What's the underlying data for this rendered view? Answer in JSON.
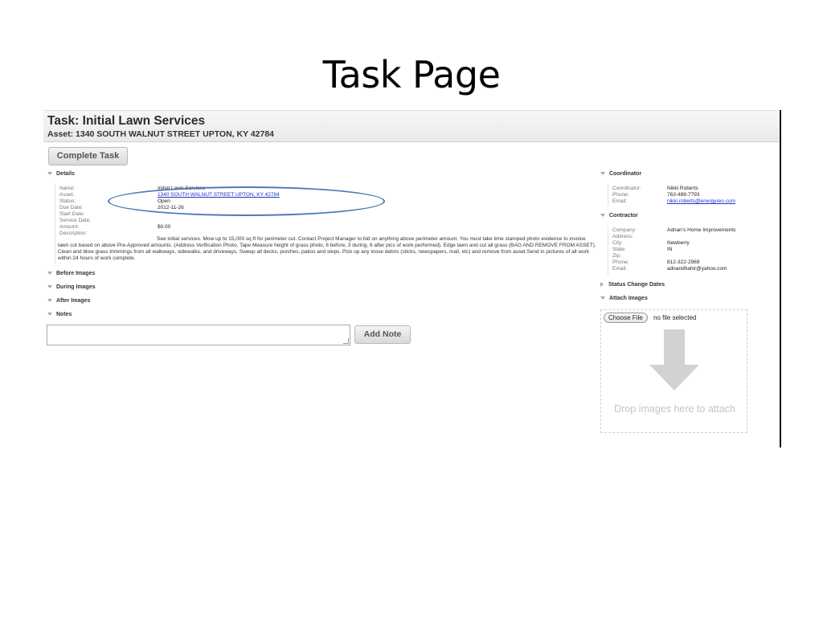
{
  "slide": {
    "title": "Task Page"
  },
  "header": {
    "task_title": "Task: Initial Lawn Services",
    "asset_title": "Asset: 1340 SOUTH WALNUT STREET UPTON, KY 42784"
  },
  "actions": {
    "complete_task": "Complete Task",
    "add_note": "Add Note"
  },
  "sections": {
    "details": "Details",
    "before_images": "Before Images",
    "during_images": "During Images",
    "after_images": "After Images",
    "notes": "Notes",
    "coordinator": "Coordinator",
    "contractor": "Contractor",
    "status_change_dates": "Status Change Dates",
    "attach_images": "Attach Images"
  },
  "details": {
    "labels": {
      "name": "Name:",
      "asset": "Asset:",
      "status": "Status:",
      "due_date": "Due Date:",
      "start_date": "Start Date:",
      "service_date": "Service Date:",
      "amount": "Amount:",
      "description": "Description:"
    },
    "values": {
      "name": "Initial Lawn Services",
      "asset": "1340 SOUTH WALNUT STREET UPTON, KY 42784",
      "status": "Open",
      "due_date": "2012-11-26",
      "amount": "$0.00",
      "description": "See initial services. Mow up to 15,000 sq ft for perimeter cut. Contact Project Manager to bid on anything above perimeter amount. You must take time stamped photo evidence to invoice lawn cut based on above Pre-Approved amounts. (Address Verification Photo, Tape Measure height of grass photo, 6 before, 3 during, 6 after pics of work performed). Edge lawn and cut all grass (BAG AND REMOVE FROM ASSET). Clean and blow grass trimmings from all walkways, sidewalks, and driveways. Sweep all decks, porches, patios and steps. Pick up any loose debris (sticks, newspapers, mail, etc) and remove from asset.Send in pictures of all work within 24 hours of work complete."
    }
  },
  "coordinator": {
    "labels": {
      "coordinator": "Coordinator:",
      "phone": "Phone:",
      "email": "Email:"
    },
    "values": {
      "coordinator": "Nikki Roberts",
      "phone": "763-489-7793",
      "email": "nikki.roberts@energyreo.com"
    }
  },
  "contractor": {
    "labels": {
      "company": "Company:",
      "address": "Address:",
      "city": "City:",
      "state": "State:",
      "zip": "Zip:",
      "phone": "Phone:",
      "email": "Email:"
    },
    "values": {
      "company": "Adnan's Home Improvements",
      "city": "Newberry",
      "state": "IN",
      "phone": "812-322-2969",
      "email": "adnandhahir@yahoo.com"
    }
  },
  "attach": {
    "choose_file": "Choose File",
    "no_file": "no file selected",
    "drop_text": "Drop images here to attach"
  },
  "colors": {
    "link": "#1a33c9",
    "annotation_ellipse": "#4d7ab4",
    "header_bar": "#ececec"
  }
}
